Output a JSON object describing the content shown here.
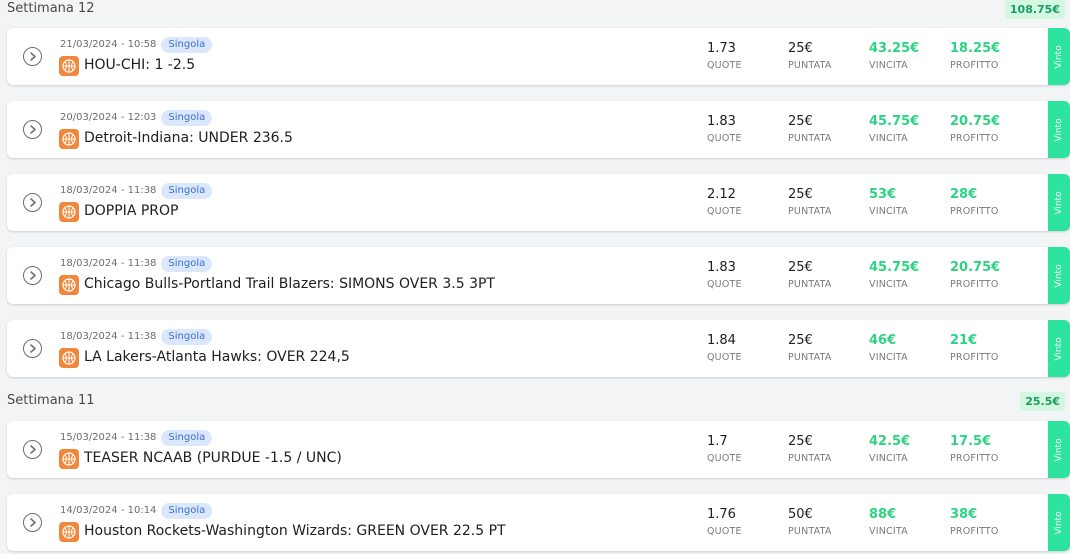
{
  "colors": {
    "win_green": "#2ed383",
    "status_tab": "#2de3a0",
    "badge_bg": "#dbe7fb",
    "badge_text": "#3b6fd6",
    "sport_icon": "#f0873a",
    "week_total_bg": "#d3f7e1"
  },
  "icons": {
    "expand": "chevron-right-circle-icon",
    "sport": "basketball-icon"
  },
  "weeks": [
    {
      "title": "Settimana 12",
      "total": "108.75€",
      "bets": [
        {
          "date": "21/03/2024 - 10:58",
          "type": "Singola",
          "title": "HOU-CHI: 1 -2.5",
          "quote": "1.73",
          "stake": "25€",
          "win": "43.25€",
          "profit": "18.25€",
          "status": "Vinto"
        },
        {
          "date": "20/03/2024 - 12:03",
          "type": "Singola",
          "title": "Detroit-Indiana: UNDER 236.5",
          "quote": "1.83",
          "stake": "25€",
          "win": "45.75€",
          "profit": "20.75€",
          "status": "Vinto"
        },
        {
          "date": "18/03/2024 - 11:38",
          "type": "Singola",
          "title": "DOPPIA PROP",
          "quote": "2.12",
          "stake": "25€",
          "win": "53€",
          "profit": "28€",
          "status": "Vinto"
        },
        {
          "date": "18/03/2024 - 11:38",
          "type": "Singola",
          "title": "Chicago Bulls-Portland Trail Blazers: SIMONS OVER 3.5 3PT",
          "quote": "1.83",
          "stake": "25€",
          "win": "45.75€",
          "profit": "20.75€",
          "status": "Vinto"
        },
        {
          "date": "18/03/2024 - 11:38",
          "type": "Singola",
          "title": "LA Lakers-Atlanta Hawks: OVER 224,5",
          "quote": "1.84",
          "stake": "25€",
          "win": "46€",
          "profit": "21€",
          "status": "Vinto"
        }
      ]
    },
    {
      "title": "Settimana 11",
      "total": "25.5€",
      "bets": [
        {
          "date": "15/03/2024 - 11:38",
          "type": "Singola",
          "title": "TEASER NCAAB (PURDUE -1.5 / UNC)",
          "quote": "1.7",
          "stake": "25€",
          "win": "42.5€",
          "profit": "17.5€",
          "status": "Vinto"
        },
        {
          "date": "14/03/2024 - 10:14",
          "type": "Singola",
          "title": "Houston Rockets-Washington Wizards: GREEN OVER 22.5 PT",
          "quote": "1.76",
          "stake": "50€",
          "win": "88€",
          "profit": "38€",
          "status": "Vinto"
        }
      ]
    }
  ],
  "labels": {
    "quote": "QUOTE",
    "stake": "PUNTATA",
    "win": "VINCITA",
    "profit": "PROFITTO"
  }
}
